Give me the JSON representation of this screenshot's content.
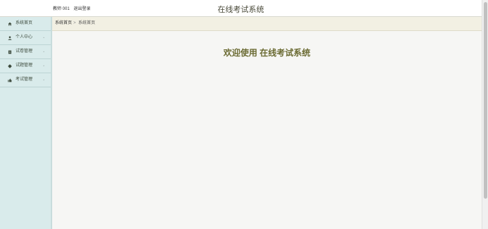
{
  "header": {
    "user": "教师 001",
    "logout_label": "退出登录",
    "app_title": "在线考试系统"
  },
  "sidebar": {
    "items": [
      {
        "label": "系统首页",
        "icon": "home-icon"
      },
      {
        "label": "个人中心",
        "icon": "user-icon"
      },
      {
        "label": "试卷管理",
        "icon": "paper-icon"
      },
      {
        "label": "试题管理",
        "icon": "question-icon"
      },
      {
        "label": "考试管理",
        "icon": "exam-icon"
      }
    ]
  },
  "breadcrumb": {
    "root": "系统首页",
    "separator": ">",
    "current": "系统首页"
  },
  "main": {
    "welcome": "欢迎使用 在线考试系统"
  },
  "colors": {
    "sidebar_bg": "#d9ebeb",
    "breadcrumb_bg": "#f2f0e3",
    "welcome_text": "#6b6b33"
  }
}
